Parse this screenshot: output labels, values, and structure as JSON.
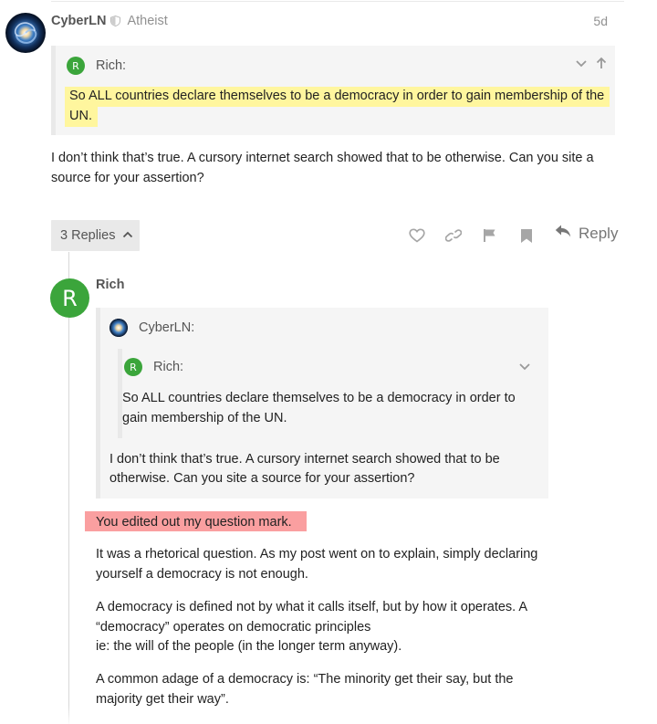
{
  "post1": {
    "username": "CyberLN",
    "user_title": "Atheist",
    "date": "5d",
    "quote": {
      "author": "Rich:",
      "avatar_letter": "R",
      "text": "So ALL countries declare themselves to be a democracy in order to gain membership of the UN."
    },
    "body": "I don’t think that’s true. A cursory internet search showed that to be otherwise. Can you site a source for your assertion?",
    "actions": {
      "replies_label": "3 Replies",
      "reply_label": "Reply"
    }
  },
  "post2": {
    "username": "Rich",
    "avatar_letter": "R",
    "outer_quote": {
      "author": "CyberLN:",
      "inner_quote": {
        "author": "Rich:",
        "avatar_letter": "R",
        "text": "So ALL countries declare themselves to be a democracy in order to gain membership of the UN."
      },
      "text": "I don’t think that’s true. A cursory internet search showed that to be otherwise. Can you site a source for your assertion?"
    },
    "highlight": "You edited out my question mark.",
    "paragraphs": [
      "It was a rhetorical question. As my post went on to explain, simply declaring yourself a democracy is not enough.",
      "A democracy is defined not by what it calls itself, but by how it operates. A “democracy” operates on democratic principles",
      "ie: the will of the people (in the longer term anyway).",
      "A common adage of a democracy is: “The minority get their say, but the majority get their way”."
    ]
  },
  "colors": {
    "rich_avatar": "#3ba53b",
    "quote_highlight": "#fff69e",
    "red_highlight": "#fa9fa0",
    "quote_bg": "#f5f5f5"
  }
}
